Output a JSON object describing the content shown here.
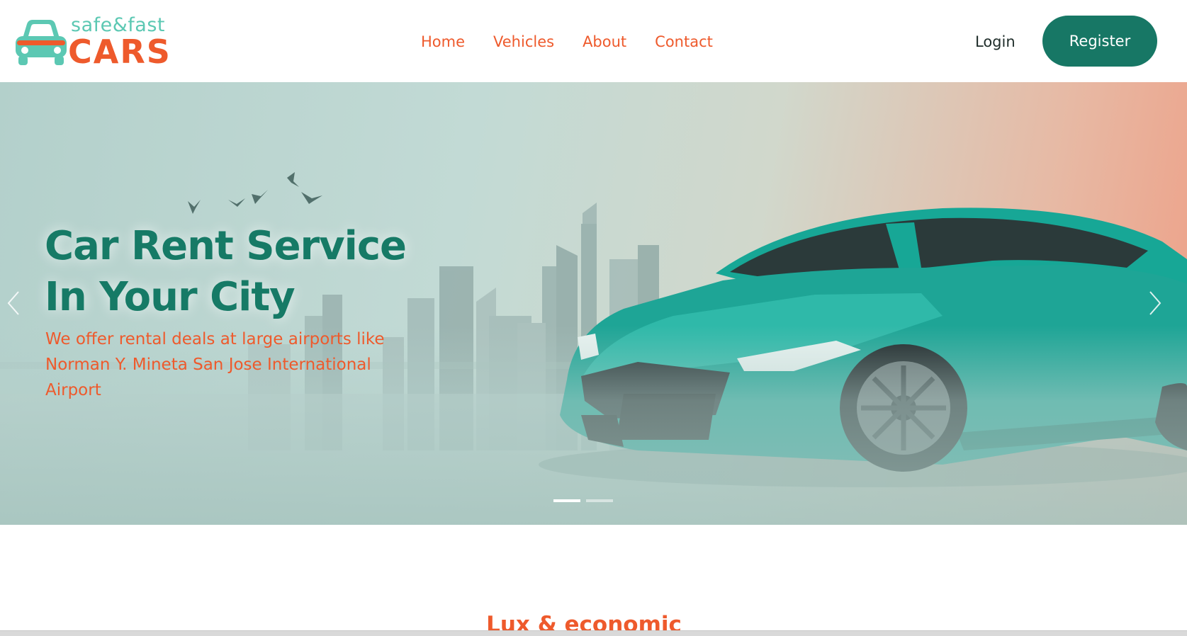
{
  "brand": {
    "tagline": "safe&fast",
    "name": "CARS",
    "primary_color": "#177765",
    "accent_color": "#ee5a2c",
    "logo_icon": "car-icon"
  },
  "nav": {
    "items": [
      {
        "label": "Home"
      },
      {
        "label": "Vehicles"
      },
      {
        "label": "About"
      },
      {
        "label": "Contact"
      }
    ],
    "login_label": "Login",
    "register_label": "Register"
  },
  "hero": {
    "title_line1": "Car Rent Service",
    "title_line2": "In Your City",
    "subtitle": "We offer rental deals at large airports like Norman Y. Mineta San Jose International Airport",
    "prev_icon": "chevron-left-icon",
    "next_icon": "chevron-right-icon",
    "slide_count": 2,
    "active_slide": 1
  },
  "section": {
    "title": "Lux & economic"
  }
}
